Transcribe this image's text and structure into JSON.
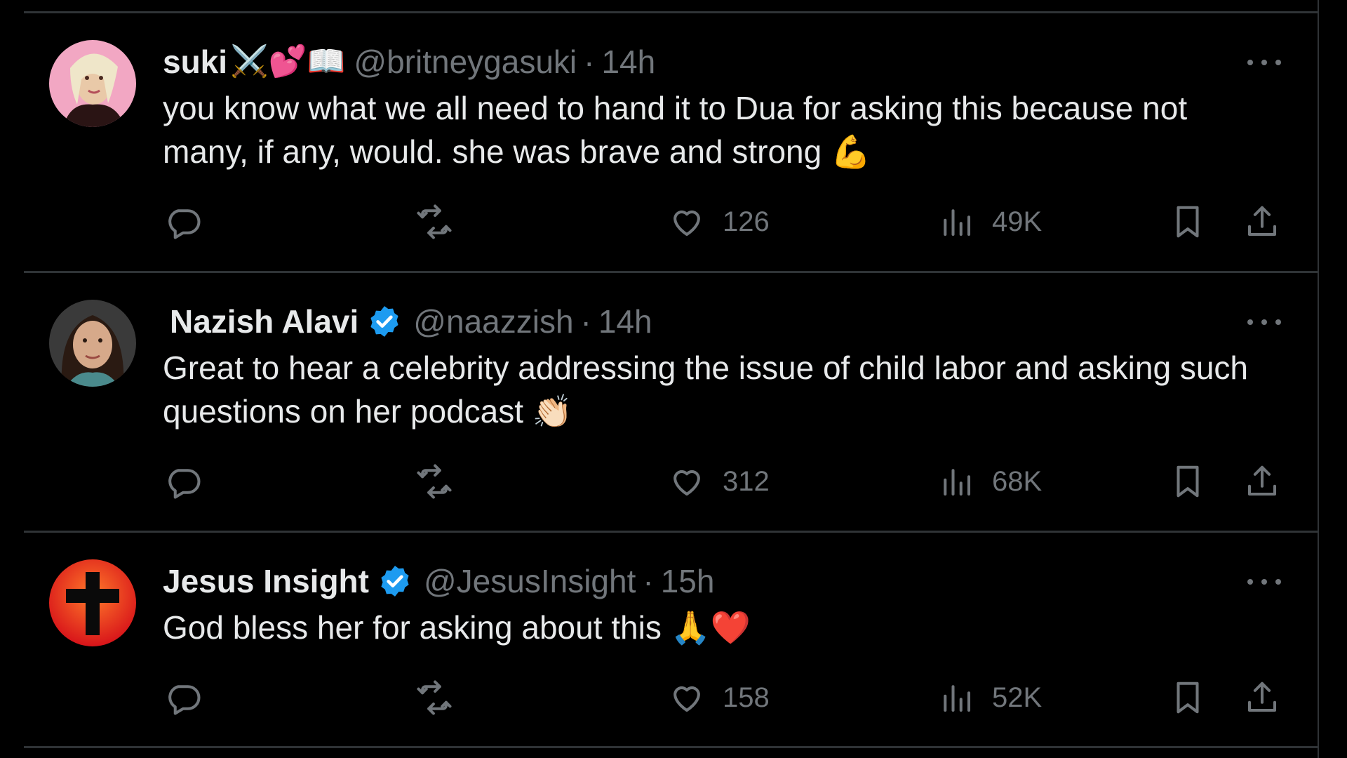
{
  "tweets": [
    {
      "name": "suki",
      "name_emoji": "⚔️💕📖",
      "verified": false,
      "handle": "@britneygasuki",
      "separator": "·",
      "time": "14h",
      "text": "you know what we all need to hand it to Dua for asking this because not many, if any, would. she was brave and strong",
      "text_emoji": "💪",
      "likes": "126",
      "views": "49K",
      "avatar_color": "#f2a7c3"
    },
    {
      "name": "Nazish Alavi",
      "verified": true,
      "handle": "@naazzish",
      "separator": "·",
      "time": "14h",
      "text": "Great to hear a celebrity addressing the issue of child labor and asking such questions on her podcast",
      "text_emoji": "👏🏻",
      "likes": "312",
      "views": "68K",
      "avatar_color": "#3a3a3a"
    },
    {
      "name": "Jesus Insight",
      "verified": true,
      "handle": "@JesusInsight",
      "separator": "·",
      "time": "15h",
      "text": "God bless her for asking about this",
      "text_emoji": "🙏❤️",
      "likes": "158",
      "views": "52K",
      "avatar_color": "#e8321e"
    }
  ],
  "colors": {
    "background": "#000000",
    "text_primary": "#e7e9ea",
    "text_secondary": "#71767b",
    "divider": "#2f3336",
    "verified_blue": "#1d9bf0"
  },
  "icons": [
    "reply-icon",
    "retweet-icon",
    "like-icon",
    "views-icon",
    "bookmark-icon",
    "share-icon",
    "more-icon",
    "verified-badge-icon"
  ]
}
